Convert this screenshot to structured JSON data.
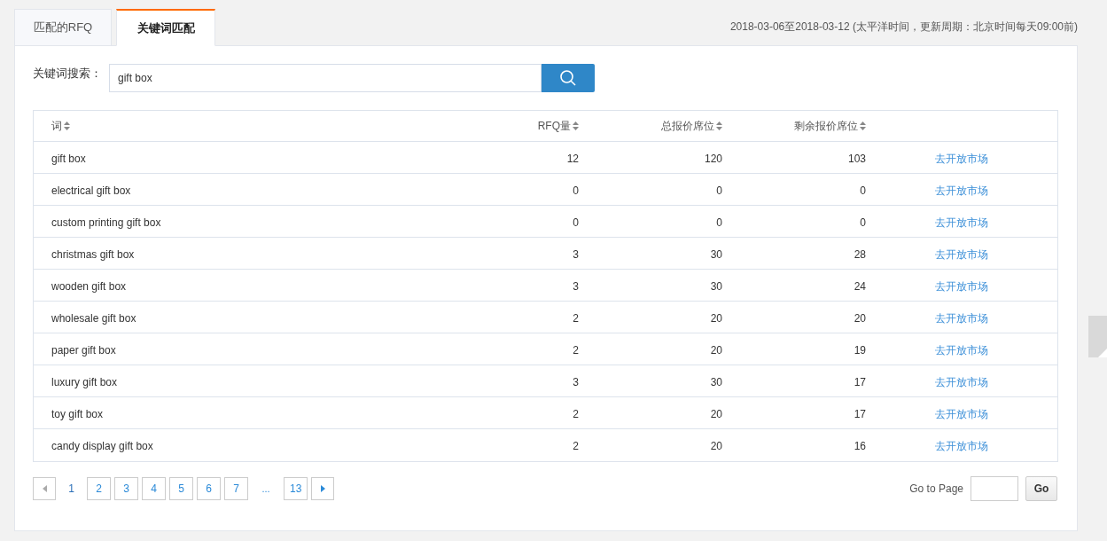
{
  "tabs": [
    {
      "label": "匹配的RFQ",
      "selected": false
    },
    {
      "label": "关键词匹配",
      "selected": true
    }
  ],
  "date_note": "2018-03-06至2018-03-12 (太平洋时间，更新周期：北京时间每天09:00前)",
  "search": {
    "label": "关键词搜索：",
    "value": "gift box"
  },
  "table": {
    "columns": [
      {
        "label": "词"
      },
      {
        "label": "RFQ量"
      },
      {
        "label": "总报价席位"
      },
      {
        "label": "剩余报价席位"
      }
    ],
    "rows": [
      {
        "word": "gift box",
        "rfq": "12",
        "total": "120",
        "remaining": "103",
        "link": "去开放市场"
      },
      {
        "word": "electrical gift box",
        "rfq": "0",
        "total": "0",
        "remaining": "0",
        "link": "去开放市场"
      },
      {
        "word": "custom printing gift box",
        "rfq": "0",
        "total": "0",
        "remaining": "0",
        "link": "去开放市场"
      },
      {
        "word": "christmas gift box",
        "rfq": "3",
        "total": "30",
        "remaining": "28",
        "link": "去开放市场"
      },
      {
        "word": "wooden gift box",
        "rfq": "3",
        "total": "30",
        "remaining": "24",
        "link": "去开放市场"
      },
      {
        "word": "wholesale gift box",
        "rfq": "2",
        "total": "20",
        "remaining": "20",
        "link": "去开放市场"
      },
      {
        "word": "paper gift box",
        "rfq": "2",
        "total": "20",
        "remaining": "19",
        "link": "去开放市场"
      },
      {
        "word": "luxury gift box",
        "rfq": "3",
        "total": "30",
        "remaining": "17",
        "link": "去开放市场"
      },
      {
        "word": "toy gift box",
        "rfq": "2",
        "total": "20",
        "remaining": "17",
        "link": "去开放市场"
      },
      {
        "word": "candy display gift box",
        "rfq": "2",
        "total": "20",
        "remaining": "16",
        "link": "去开放市场"
      }
    ]
  },
  "pagination": {
    "items": [
      {
        "kind": "prev",
        "disabled": true
      },
      {
        "kind": "page",
        "label": "1",
        "selected": true
      },
      {
        "kind": "page",
        "label": "2",
        "selected": false
      },
      {
        "kind": "page",
        "label": "3",
        "selected": false
      },
      {
        "kind": "page",
        "label": "4",
        "selected": false
      },
      {
        "kind": "page",
        "label": "5",
        "selected": false
      },
      {
        "kind": "page",
        "label": "6",
        "selected": false
      },
      {
        "kind": "page",
        "label": "7",
        "selected": false
      },
      {
        "kind": "ellipsis",
        "label": "..."
      },
      {
        "kind": "page",
        "label": "13",
        "selected": false
      },
      {
        "kind": "next",
        "disabled": false
      }
    ],
    "goto_label": "Go to Page",
    "go_button": "Go"
  }
}
